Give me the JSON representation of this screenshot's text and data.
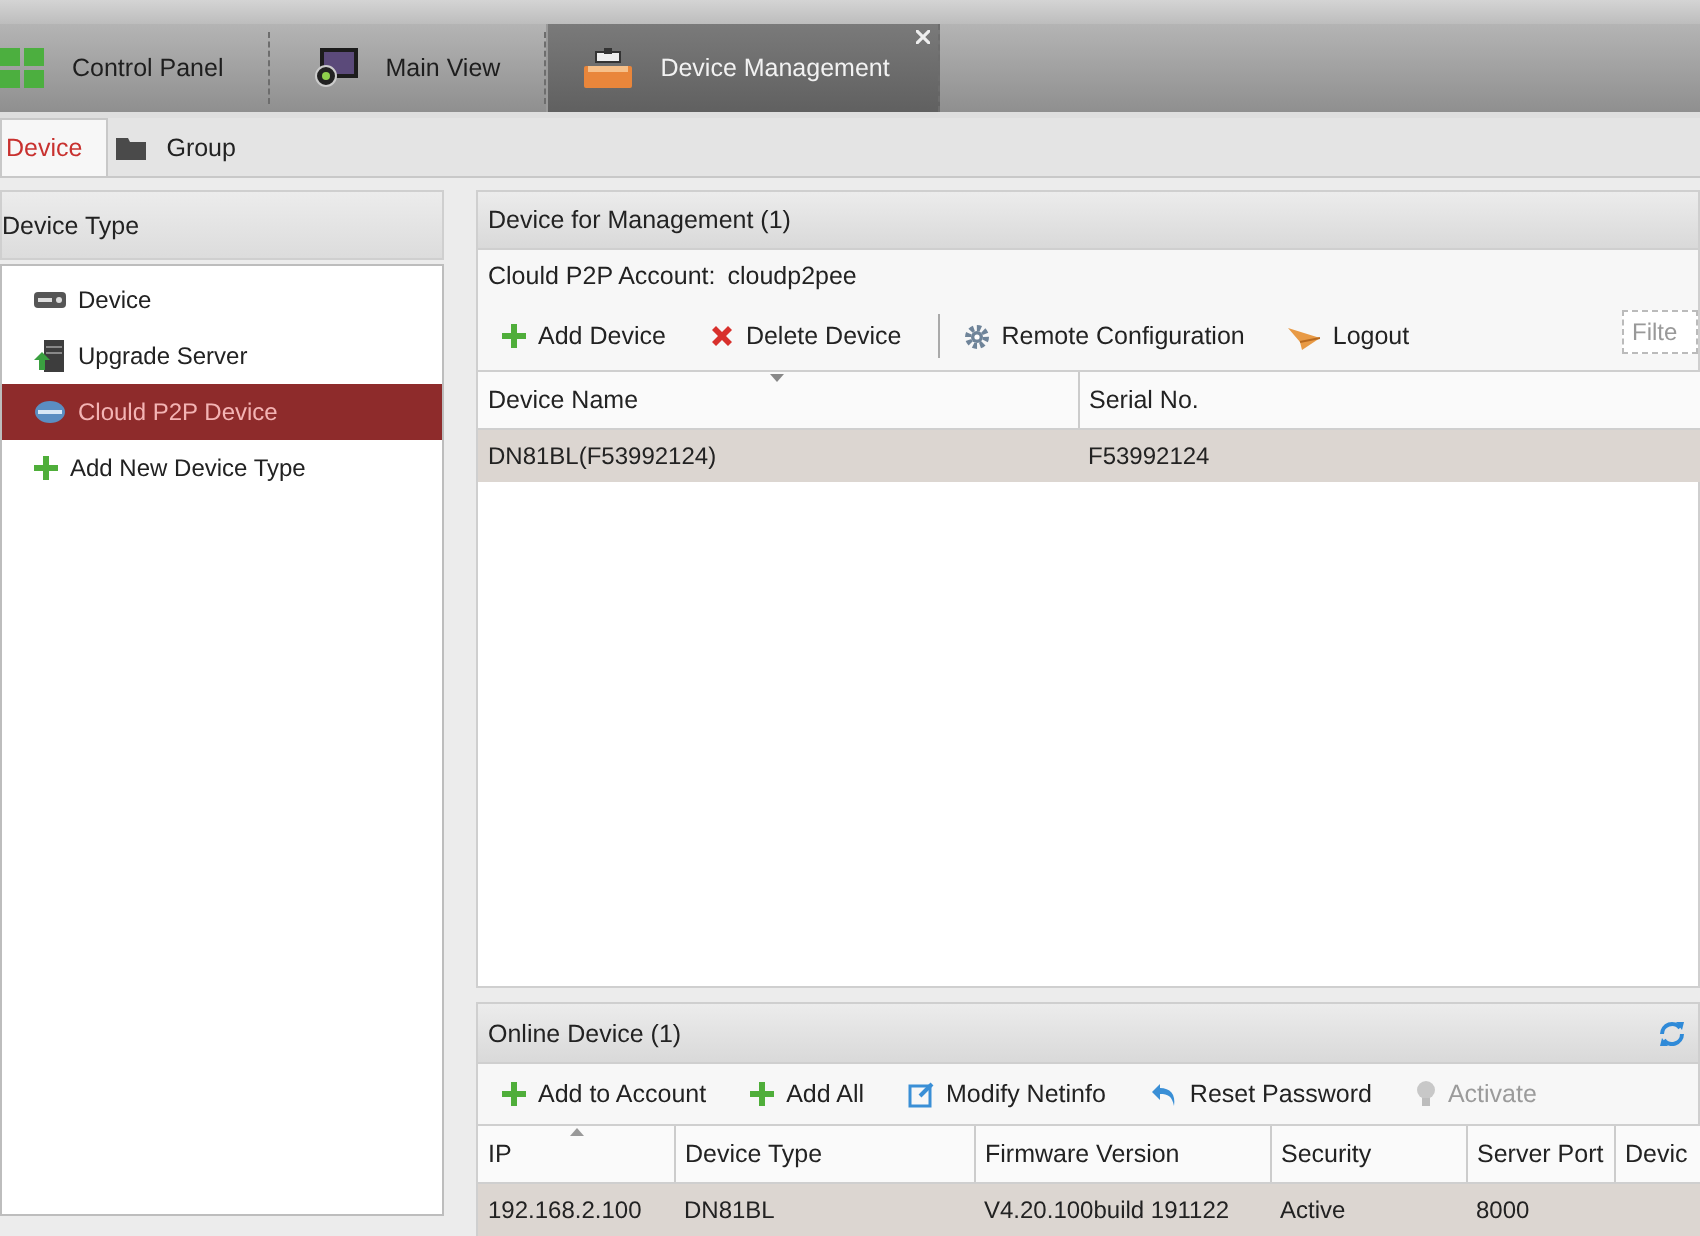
{
  "top_tabs": [
    {
      "label": "Control Panel",
      "selected": false
    },
    {
      "label": "Main View",
      "selected": false
    },
    {
      "label": "Device Management",
      "selected": true
    }
  ],
  "sub_tabs": [
    {
      "label": "Device",
      "selected": true
    },
    {
      "label": "Group",
      "selected": false
    }
  ],
  "device_type": {
    "title": "Device Type",
    "items": [
      {
        "label": "Device",
        "kind": "device",
        "selected": false
      },
      {
        "label": "Upgrade Server",
        "kind": "server",
        "selected": false
      },
      {
        "label": "Clould P2P Device",
        "kind": "cloud",
        "selected": true
      },
      {
        "label": "Add New Device Type",
        "kind": "add",
        "selected": false
      }
    ]
  },
  "management": {
    "title": "Device for Management (1)",
    "account_label": "Clould P2P Account:",
    "account": "cloudp2pee",
    "toolbar": [
      {
        "label": "Add Device",
        "kind": "add",
        "disabled": false
      },
      {
        "label": "Delete Device",
        "kind": "delete",
        "disabled": false
      },
      {
        "label": "Remote Configuration",
        "kind": "gear",
        "disabled": false
      },
      {
        "label": "Logout",
        "kind": "logout",
        "disabled": false
      }
    ],
    "filter": {
      "placeholder": "Filte"
    },
    "columns": [
      "Device Name",
      "Serial No."
    ],
    "rows": [
      {
        "cells": [
          "DN81BL(F53992124)",
          "F53992124"
        ],
        "selected": true
      }
    ]
  },
  "online": {
    "title": "Online Device (1)",
    "toolbar": [
      {
        "label": "Add to Account",
        "kind": "add",
        "disabled": false
      },
      {
        "label": "Add All",
        "kind": "add",
        "disabled": false
      },
      {
        "label": "Modify Netinfo",
        "kind": "edit",
        "disabled": false
      },
      {
        "label": "Reset Password",
        "kind": "reset",
        "disabled": false
      },
      {
        "label": "Activate",
        "kind": "bulb",
        "disabled": true
      }
    ],
    "columns": [
      "IP",
      "Device Type",
      "Firmware Version",
      "Security",
      "Server Port",
      "Devic"
    ],
    "rows": [
      {
        "cells": [
          "192.168.2.100",
          "DN81BL",
          "V4.20.100build 191122",
          "Active",
          "8000",
          ""
        ],
        "selected": true
      }
    ]
  }
}
